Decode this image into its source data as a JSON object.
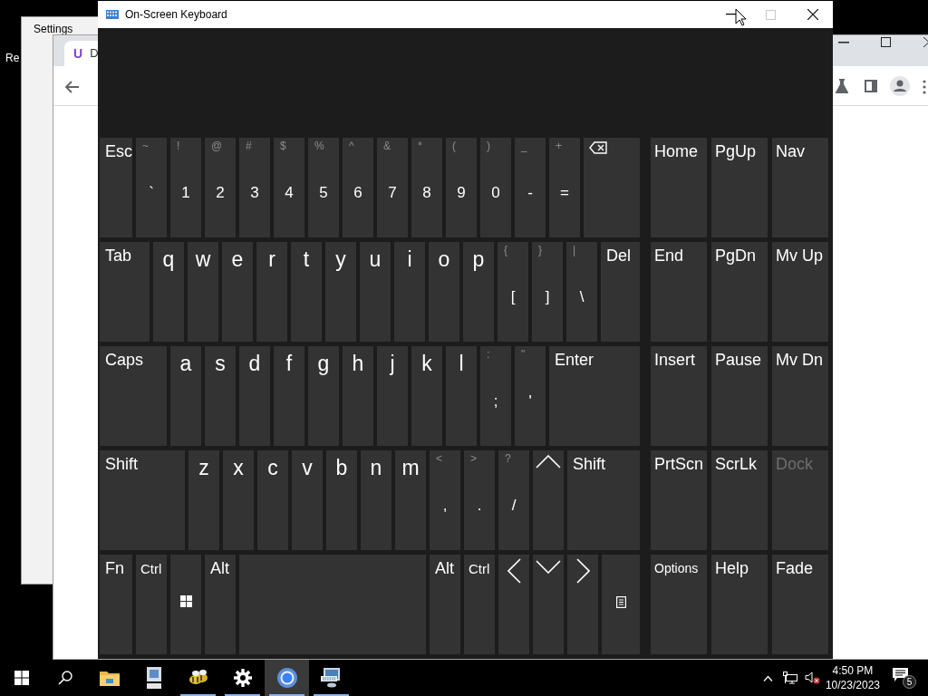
{
  "desktop": {
    "label": "Re"
  },
  "settings_window": {
    "title": "Settings"
  },
  "browser_window": {
    "tab_logo": "U",
    "tab_title": "D"
  },
  "keyboard": {
    "title": "On-Screen Keyboard",
    "maximize_disabled": true,
    "main_rows": [
      [
        {
          "kind": "word",
          "label": "Esc"
        },
        {
          "kind": "dual",
          "shift": "~",
          "label": "`"
        },
        {
          "kind": "dual",
          "shift": "!",
          "label": "1"
        },
        {
          "kind": "dual",
          "shift": "@",
          "label": "2"
        },
        {
          "kind": "dual",
          "shift": "#",
          "label": "3"
        },
        {
          "kind": "dual",
          "shift": "$",
          "label": "4"
        },
        {
          "kind": "dual",
          "shift": "%",
          "label": "5"
        },
        {
          "kind": "dual",
          "shift": "^",
          "label": "6"
        },
        {
          "kind": "dual",
          "shift": "&",
          "label": "7"
        },
        {
          "kind": "dual",
          "shift": "*",
          "label": "8"
        },
        {
          "kind": "dual",
          "shift": "(",
          "label": "9"
        },
        {
          "kind": "dual",
          "shift": ")",
          "label": "0"
        },
        {
          "kind": "dual",
          "shift": "_",
          "label": "-"
        },
        {
          "kind": "dual",
          "shift": "+",
          "label": "="
        },
        {
          "kind": "backspace"
        }
      ],
      [
        {
          "kind": "word",
          "label": "Tab"
        },
        {
          "kind": "letter",
          "label": "q"
        },
        {
          "kind": "letter",
          "label": "w"
        },
        {
          "kind": "letter",
          "label": "e"
        },
        {
          "kind": "letter",
          "label": "r"
        },
        {
          "kind": "letter",
          "label": "t"
        },
        {
          "kind": "letter",
          "label": "y"
        },
        {
          "kind": "letter",
          "label": "u"
        },
        {
          "kind": "letter",
          "label": "i"
        },
        {
          "kind": "letter",
          "label": "o"
        },
        {
          "kind": "letter",
          "label": "p"
        },
        {
          "kind": "dual",
          "shift": "{",
          "label": "["
        },
        {
          "kind": "dual",
          "shift": "}",
          "label": "]"
        },
        {
          "kind": "dual",
          "shift": "|",
          "label": "\\"
        },
        {
          "kind": "word",
          "label": "Del"
        }
      ],
      [
        {
          "kind": "word",
          "label": "Caps"
        },
        {
          "kind": "letter",
          "label": "a"
        },
        {
          "kind": "letter",
          "label": "s"
        },
        {
          "kind": "letter",
          "label": "d"
        },
        {
          "kind": "letter",
          "label": "f"
        },
        {
          "kind": "letter",
          "label": "g"
        },
        {
          "kind": "letter",
          "label": "h"
        },
        {
          "kind": "letter",
          "label": "j"
        },
        {
          "kind": "letter",
          "label": "k"
        },
        {
          "kind": "letter",
          "label": "l"
        },
        {
          "kind": "dual",
          "shift": ":",
          "label": ";"
        },
        {
          "kind": "dual",
          "shift": "\"",
          "label": "'"
        },
        {
          "kind": "word",
          "label": "Enter"
        }
      ],
      [
        {
          "kind": "word",
          "label": "Shift"
        },
        {
          "kind": "letter",
          "label": "z"
        },
        {
          "kind": "letter",
          "label": "x"
        },
        {
          "kind": "letter",
          "label": "c"
        },
        {
          "kind": "letter",
          "label": "v"
        },
        {
          "kind": "letter",
          "label": "b"
        },
        {
          "kind": "letter",
          "label": "n"
        },
        {
          "kind": "letter",
          "label": "m"
        },
        {
          "kind": "dual",
          "shift": "<",
          "label": ","
        },
        {
          "kind": "dual",
          "shift": ">",
          "label": "."
        },
        {
          "kind": "dual",
          "shift": "?",
          "label": "/"
        },
        {
          "kind": "up"
        },
        {
          "kind": "word",
          "label": "Shift"
        }
      ],
      [
        {
          "kind": "word",
          "label": "Fn"
        },
        {
          "kind": "small",
          "label": "Ctrl"
        },
        {
          "kind": "windows"
        },
        {
          "kind": "word",
          "label": "Alt"
        },
        {
          "kind": "space"
        },
        {
          "kind": "word",
          "label": "Alt"
        },
        {
          "kind": "small",
          "label": "Ctrl"
        },
        {
          "kind": "left"
        },
        {
          "kind": "down"
        },
        {
          "kind": "right"
        },
        {
          "kind": "menu"
        }
      ]
    ],
    "side_rows": [
      [
        {
          "label": "Home",
          "disabled": false
        },
        {
          "label": "PgUp",
          "disabled": false
        },
        {
          "label": "Nav",
          "disabled": false
        }
      ],
      [
        {
          "label": "End",
          "disabled": false
        },
        {
          "label": "PgDn",
          "disabled": false
        },
        {
          "label": "Mv Up",
          "disabled": false
        }
      ],
      [
        {
          "label": "Insert",
          "disabled": false
        },
        {
          "label": "Pause",
          "disabled": false
        },
        {
          "label": "Mv Dn",
          "disabled": false
        }
      ],
      [
        {
          "label": "PrtScn",
          "disabled": false
        },
        {
          "label": "ScrLk",
          "disabled": false
        },
        {
          "label": "Dock",
          "disabled": true
        }
      ],
      [
        {
          "label": "Options",
          "disabled": false
        },
        {
          "label": "Help",
          "disabled": false
        },
        {
          "label": "Fade",
          "disabled": false
        }
      ]
    ]
  },
  "taskbar": {
    "apps": [
      {
        "kind": "explorer",
        "running": false,
        "selected": false
      },
      {
        "kind": "computer",
        "running": false,
        "selected": false
      },
      {
        "kind": "bees",
        "running": true,
        "selected": false
      },
      {
        "kind": "gear",
        "running": true,
        "selected": false
      },
      {
        "kind": "browser",
        "running": true,
        "selected": true
      },
      {
        "kind": "keyboard",
        "running": true,
        "selected": false
      }
    ],
    "time": "4:50 PM",
    "date": "10/23/2023",
    "notifications": "5"
  }
}
